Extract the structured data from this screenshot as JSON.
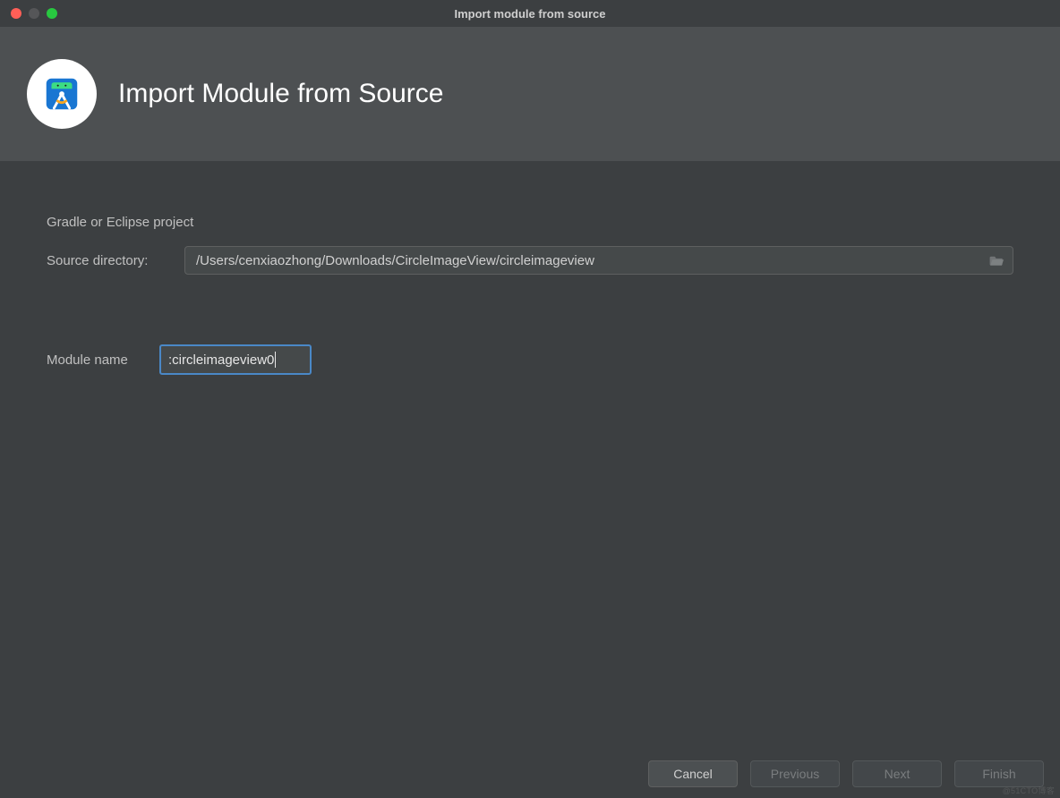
{
  "window": {
    "title": "Import module from source"
  },
  "header": {
    "title": "Import Module from Source"
  },
  "form": {
    "project_type": "Gradle or Eclipse project",
    "source_label": "Source directory:",
    "source_path": "/Users/cenxiaozhong/Downloads/CircleImageView/circleimageview",
    "module_label": "Module name",
    "module_value": ":circleimageview0"
  },
  "footer": {
    "cancel": "Cancel",
    "previous": "Previous",
    "next": "Next",
    "finish": "Finish"
  },
  "watermark": "@51CTO博客"
}
